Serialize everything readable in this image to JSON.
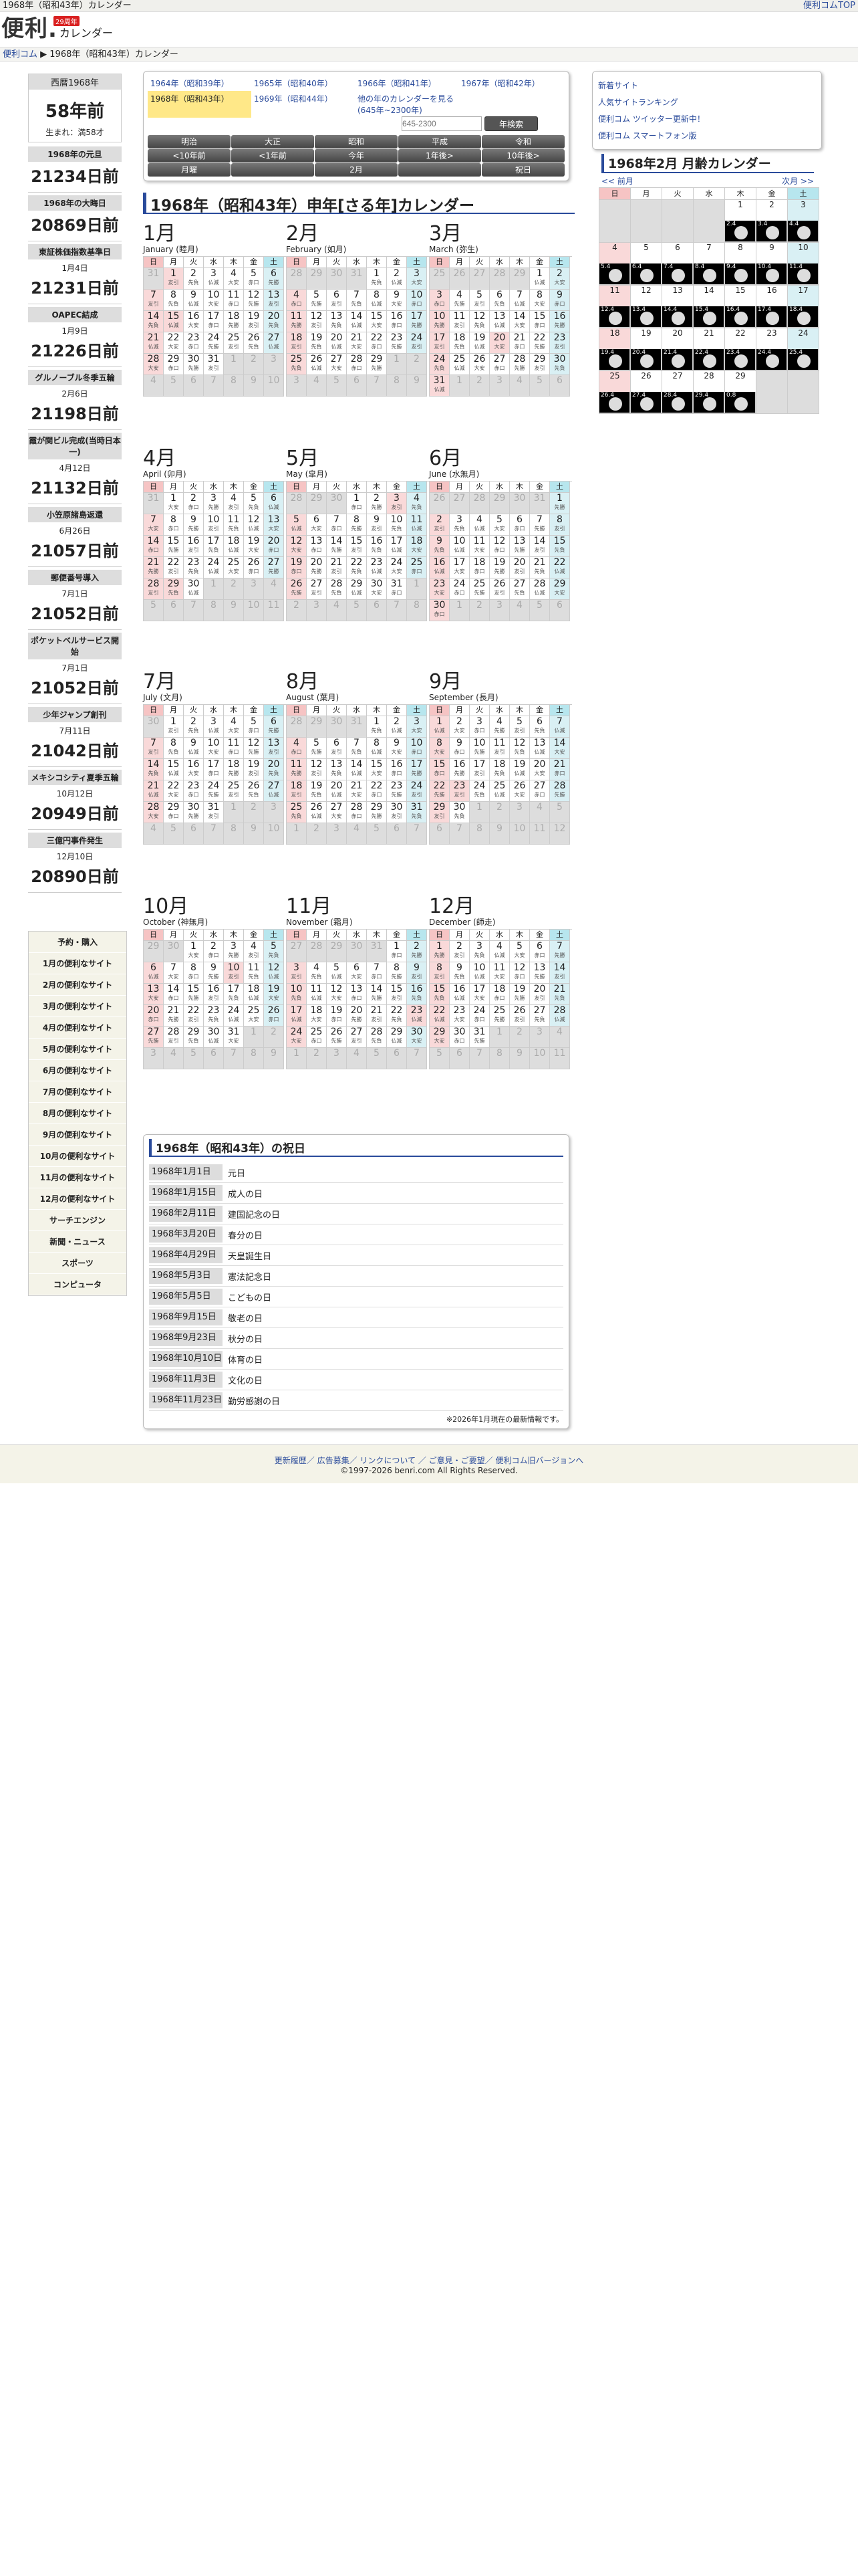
{
  "top": {
    "title": "1968年（昭和43年）カレンダー",
    "toplink": "便利コムTOP"
  },
  "logo": {
    "text": "便利",
    "dot": ".",
    "cal": "カレンダー",
    "badge": "29周年"
  },
  "crumb": {
    "home": "便利コム",
    "page": "1968年（昭和43年）カレンダー"
  },
  "ago": {
    "head": "西暦1968年",
    "big": "58年前",
    "small": "生まれ：満58才"
  },
  "events": [
    {
      "h": "1968年の元旦",
      "d": "",
      "n": "21234日前"
    },
    {
      "h": "1968年の大晦日",
      "d": "",
      "n": "20869日前"
    },
    {
      "h": "東証株価指数基準日",
      "d": "1月4日",
      "n": "21231日前"
    },
    {
      "h": "OAPEC結成",
      "d": "1月9日",
      "n": "21226日前"
    },
    {
      "h": "グルノーブル冬季五輪",
      "d": "2月6日",
      "n": "21198日前"
    },
    {
      "h": "霞が関ビル完成(当時日本一)",
      "d": "4月12日",
      "n": "21132日前"
    },
    {
      "h": "小笠原諸島返還",
      "d": "6月26日",
      "n": "21057日前"
    },
    {
      "h": "郵便番号導入",
      "d": "7月1日",
      "n": "21052日前"
    },
    {
      "h": "ポケットベルサービス開始",
      "d": "7月1日",
      "n": "21052日前"
    },
    {
      "h": "少年ジャンプ創刊",
      "d": "7月11日",
      "n": "21042日前"
    },
    {
      "h": "メキシコシティ夏季五輪",
      "d": "10月12日",
      "n": "20949日前"
    },
    {
      "h": "三億円事件発生",
      "d": "12月10日",
      "n": "20890日前"
    }
  ],
  "links": [
    "予約・購入",
    "1月の便利なサイト",
    "2月の便利なサイト",
    "3月の便利なサイト",
    "4月の便利なサイト",
    "5月の便利なサイト",
    "6月の便利なサイト",
    "7月の便利なサイト",
    "8月の便利なサイト",
    "9月の便利なサイト",
    "10月の便利なサイト",
    "11月の便利なサイト",
    "12月の便利なサイト",
    "サーチエンジン",
    "新聞・ニュース",
    "スポーツ",
    "コンピュータ"
  ],
  "years": [
    "1964年（昭和39年）",
    "1965年（昭和40年）",
    "1966年（昭和41年）",
    "1967年（昭和42年）",
    "1968年（昭和43年）",
    "1969年（昭和44年）",
    "他の年のカレンダーを見る (645年~2300年)"
  ],
  "form": {
    "placeholder": "645-2300",
    "button": "年検索"
  },
  "buttons": [
    "明治",
    "大正",
    "昭和",
    "平成",
    "令和",
    "<10年前",
    "<1年前",
    "今年",
    "1年後>",
    "10年後>",
    "月曜",
    "",
    "2月",
    "",
    "祝日"
  ],
  "section_title": "1968年（昭和43年）申年[さる年]カレンダー",
  "weekdays": [
    "日",
    "月",
    "火",
    "水",
    "木",
    "金",
    "土"
  ],
  "months": [
    {
      "n": "1月",
      "e": "January (睦月)"
    },
    {
      "n": "2月",
      "e": "February (如月)"
    },
    {
      "n": "3月",
      "e": "March (弥生)"
    },
    {
      "n": "4月",
      "e": "April (卯月)"
    },
    {
      "n": "5月",
      "e": "May (皐月)"
    },
    {
      "n": "6月",
      "e": "June (水無月)"
    },
    {
      "n": "7月",
      "e": "July (文月)"
    },
    {
      "n": "8月",
      "e": "August (葉月)"
    },
    {
      "n": "9月",
      "e": "September (長月)"
    },
    {
      "n": "10月",
      "e": "October (神無月)"
    },
    {
      "n": "11月",
      "e": "November (霜月)"
    },
    {
      "n": "12月",
      "e": "December (師走)"
    }
  ],
  "holidays_title": "1968年（昭和43年）の祝日",
  "holidays": [
    {
      "d": "1968年1月1日",
      "n": "元日"
    },
    {
      "d": "1968年1月15日",
      "n": "成人の日"
    },
    {
      "d": "1968年2月11日",
      "n": "建国記念の日"
    },
    {
      "d": "1968年3月20日",
      "n": "春分の日"
    },
    {
      "d": "1968年4月29日",
      "n": "天皇誕生日"
    },
    {
      "d": "1968年5月3日",
      "n": "憲法記念日"
    },
    {
      "d": "1968年5月5日",
      "n": "こどもの日"
    },
    {
      "d": "1968年9月15日",
      "n": "敬老の日"
    },
    {
      "d": "1968年9月23日",
      "n": "秋分の日"
    },
    {
      "d": "1968年10月10日",
      "n": "体育の日"
    },
    {
      "d": "1968年11月3日",
      "n": "文化の日"
    },
    {
      "d": "1968年11月23日",
      "n": "勤労感謝の日"
    }
  ],
  "hol_note": "※2026年1月現在の最新情報です。",
  "right": {
    "links": [
      "新着サイト",
      "人気サイトランキング",
      "便利コム ツイッター更新中！",
      "便利コム スマートフォン版"
    ]
  },
  "moon": {
    "title": "1968年2月 月齢カレンダー",
    "prev": "<< 前月",
    "next": "次月 >>",
    "ages": [
      "2.4",
      "3.4",
      "4.4",
      "5.4",
      "6.4",
      "7.4",
      "8.4",
      "9.4",
      "10.4",
      "11.4",
      "12.4",
      "13.4",
      "14.4",
      "15.4",
      "16.4",
      "17.4",
      "18.4",
      "19.4",
      "20.4",
      "21.4",
      "22.4",
      "23.4",
      "24.4",
      "25.4",
      "26.4",
      "27.4",
      "28.4",
      "29.4",
      "0.8"
    ]
  },
  "footer": {
    "links": "更新履歴／ 広告募集／ リンクについて ／ ご意見・ご要望／ 便利コム旧バージョンへ",
    "copy": "©1997-2026 benri.com All Rights Reserved."
  }
}
